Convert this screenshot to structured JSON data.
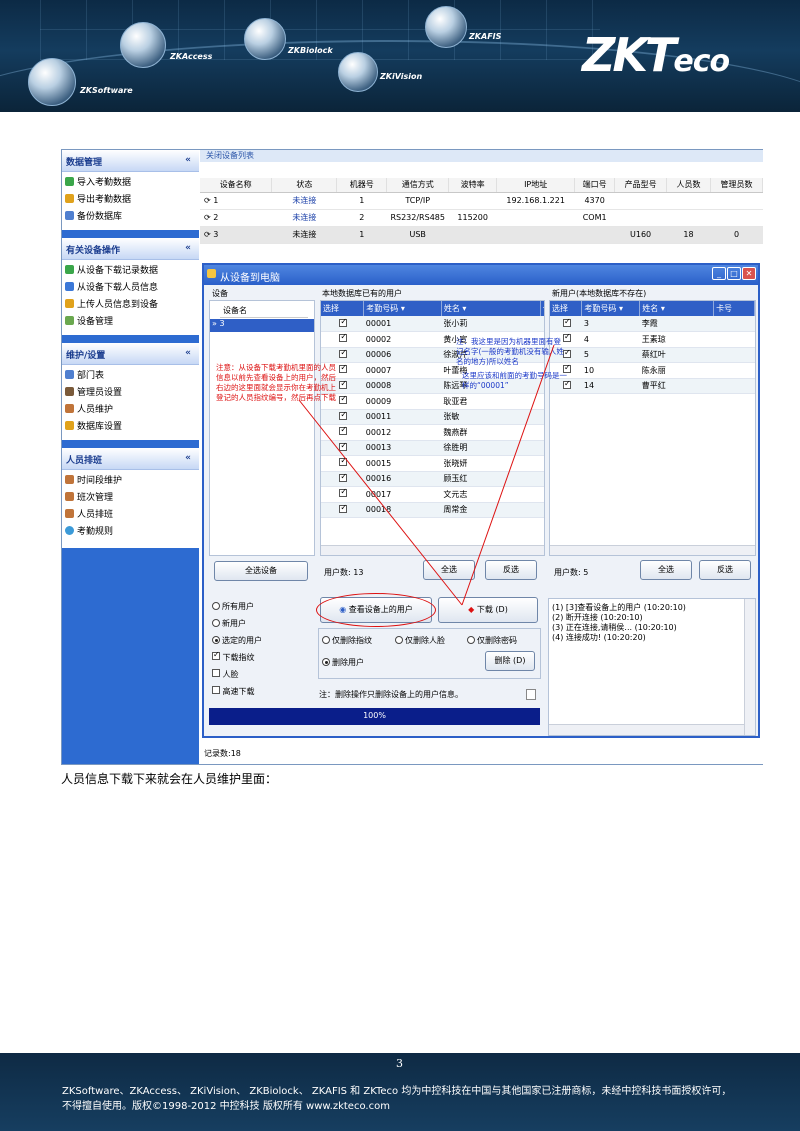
{
  "banner": {
    "products": [
      "ZKSoftware",
      "ZKAccess",
      "ZKBiolock",
      "ZKAFIS",
      "ZKiVision"
    ],
    "logo_main": "ZKT",
    "logo_eco": "eco",
    "logo_reg": "®"
  },
  "sidebar": {
    "groups": [
      {
        "title": "数据管理",
        "items": [
          "导入考勤数据",
          "导出考勤数据",
          "备份数据库"
        ]
      },
      {
        "title": "有关设备操作",
        "items": [
          "从设备下载记录数据",
          "从设备下载人员信息",
          "上传人员信息到设备",
          "设备管理"
        ]
      },
      {
        "title": "维护/设置",
        "items": [
          "部门表",
          "管理员设置",
          "人员维护",
          "数据库设置"
        ]
      },
      {
        "title": "人员排班",
        "items": [
          "时间段维护",
          "班次管理",
          "人员排班",
          "考勤规则"
        ]
      }
    ],
    "chevron": "«"
  },
  "main": {
    "toolbar_text": "关闭设备列表",
    "status_text": "记录数:18",
    "device_headers": [
      "设备名称",
      "状态",
      "机器号",
      "通信方式",
      "波特率",
      "IP地址",
      "端口号",
      "产品型号",
      "人员数",
      "管理员数"
    ],
    "device_rows": [
      [
        "1",
        "未连接",
        "1",
        "TCP/IP",
        "",
        "192.168.1.221",
        "4370",
        "",
        "",
        ""
      ],
      [
        "2",
        "未连接",
        "2",
        "RS232/RS485",
        "115200",
        "",
        "COM1",
        "",
        "",
        ""
      ],
      [
        "3",
        "未连接",
        "1",
        "USB",
        "",
        "",
        "",
        "U160",
        "18",
        "0"
      ]
    ]
  },
  "dialog": {
    "title": "从设备到电脑",
    "device_group": "设备",
    "device_col": "设备名",
    "device_item": "3",
    "local_group": "本地数据库已有的用户",
    "new_group": "新用户(本地数据库不存在)",
    "col_select": "选择",
    "col_no": "考勤号码",
    "col_name": "姓名",
    "col_card": "卡号",
    "local_users": [
      [
        "00001",
        "张小莉"
      ],
      [
        "00002",
        "黄小宣"
      ],
      [
        "00006",
        "徐淑芹"
      ],
      [
        "00007",
        "叶蕾梅"
      ],
      [
        "00008",
        "陈远琴"
      ],
      [
        "00009",
        "耿亚君"
      ],
      [
        "00011",
        "张敏"
      ],
      [
        "00012",
        "魏燕群"
      ],
      [
        "00013",
        "徐胜明"
      ],
      [
        "00015",
        "张晓妍"
      ],
      [
        "00016",
        "顾玉红"
      ],
      [
        "00017",
        "文元志"
      ],
      [
        "00018",
        "周常金"
      ]
    ],
    "new_users": [
      [
        "3",
        "李霞"
      ],
      [
        "4",
        "王素琼"
      ],
      [
        "5",
        "蔡红叶"
      ],
      [
        "10",
        "陈永丽"
      ],
      [
        "14",
        "曹平红"
      ]
    ],
    "select_all_devices": "全选设备",
    "user_count_label": "用户数:",
    "local_count": "13",
    "new_count": "5",
    "select_all": "全选",
    "invert": "反选",
    "opt_all_users": "所有用户",
    "opt_new_users": "新用户",
    "opt_selected_users": "选定的用户",
    "opt_download_fp": "下载指纹",
    "opt_face": "人脸",
    "opt_fast": "高速下载",
    "view_users_btn": "查看设备上的用户",
    "download_btn": "下载 (D)",
    "del_fp_only": "仅删除指纹",
    "del_face_only": "仅删除人脸",
    "del_pwd_only": "仅删除密码",
    "del_users": "删除用户",
    "delete_btn": "删除 (D)",
    "delete_note": "注：删除操作只删除设备上的用户信息。",
    "progress": "100%",
    "log": [
      "(1) [3]查看设备上的用户 (10:20:10)",
      "(2) 断开连接 (10:20:10)",
      "(3) 正在连接,请稍侯... (10:20:10)",
      "(4) 连接成功! (10:20:20)"
    ],
    "note_red": "注意：从设备下载考勤机里面的人员信息以前先查看设备上的用户，然后右边的这里面就会显示你在考勤机上登记的人员指纹编号，然后再点下载",
    "note_blue1": "注：我这里是因为机器里面有登记名字(一般的考勤机没有输人姓名的地方)所以姓名",
    "note_blue2": "这里应该和前面的考勤号码是一样的“00001”"
  },
  "caption": "人员信息下载下来就会在人员维护里面：",
  "footer": {
    "page_number": "3",
    "line1": "ZKSoftware、ZKAccess、 ZKiVision、 ZKBiolock、 ZKAFIS 和 ZKTeco 均为中控科技在中国与其他国家已注册商标，未经中控科技书面授权许可，",
    "line2": "不得擅自使用。版权©1998-2012 中控科技 版权所有      www.zkteco.com"
  },
  "colors": {
    "banner": "#143c5e",
    "sidebar": "#2d6bd1",
    "grid_header": "#2f5fc6",
    "progress": "#0a1e8a",
    "note_red": "#dd1111"
  }
}
